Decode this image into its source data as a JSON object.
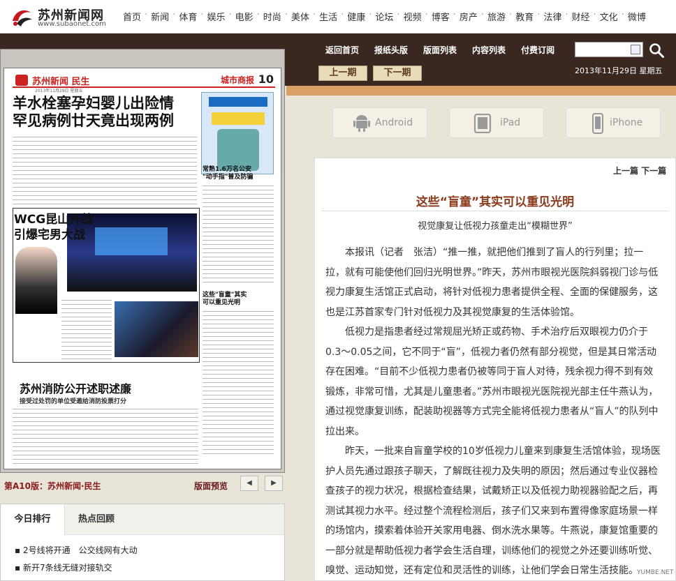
{
  "site": {
    "name": "苏州新闻网",
    "url": "www.subaonet.com"
  },
  "nav": [
    "首页",
    "新闻",
    "体育",
    "娱乐",
    "电影",
    "时尚",
    "美体",
    "生活",
    "健康",
    "论坛",
    "视频",
    "博客",
    "房产",
    "旅游",
    "教育",
    "法律",
    "财经",
    "文化",
    "微博"
  ],
  "subnav": [
    "返回首页",
    "报纸头版",
    "版面列表",
    "内容列表",
    "付费订阅"
  ],
  "search": {
    "value": ""
  },
  "issue": {
    "prev": "上一期",
    "next": "下一期",
    "date": "2013年11月29日 星期五"
  },
  "newspaper": {
    "section": "苏州新闻 民生",
    "paper_name": "城市商报",
    "page_number": "10",
    "dateline": "2013年11月29日 星期五",
    "headline": [
      "羊水栓塞孕妇婴儿出险情",
      "罕见病例廿天竟出现两例"
    ],
    "side1": [
      "常熟1.6万名公安",
      "\"动手指\"普及防骗"
    ],
    "wcg_title": [
      "WCG昆山开战",
      "引爆宅男大战"
    ],
    "side2": [
      "这些\"盲童\"其实",
      "可以重见光明"
    ],
    "fire_title": "苏州消防公开述职述廉",
    "fire_sub": "接受过处罚的单位受邀给消防投票打分"
  },
  "page_info": "第A10版：苏州新闻·民生",
  "preview_label": "版面预览",
  "ranking": {
    "tabs": [
      "今日排行",
      "热点回顾"
    ],
    "items": [
      "2号线将开通　公交线网有大动",
      "新开7条线无缝对接轨交"
    ]
  },
  "devices": [
    "Android",
    "iPad",
    "iPhone"
  ],
  "article": {
    "nav": "上一篇 下一篇",
    "title": "这些“盲童”其实可以重见光明",
    "subtitle": "视觉康复让低视力孩童走出“模糊世界”",
    "paragraphs": [
      "本报讯（记者　张洁）“推一推，就把他们推到了盲人的行列里；拉一拉，就有可能使他们回归光明世界。”昨天，苏州市眼视光医院斜弱视门诊与低视力康复生活馆正式启动，将针对低视力患者提供全程、全面的保健服务，这也是江苏首家专门针对低视力及其视觉康复的生活体验馆。",
      "低视力是指患者经过常规屈光矫正或药物、手术治疗后双眼视力仍介于0.3～0.05之间，它不同于“盲”，低视力者仍然有部分视觉，但是其日常活动存在困难。“目前不少低视力患者仍被等同于盲人对待，残余视力得不到有效锻炼，非常可惜，尤其是儿童患者。”苏州市眼视光医院视光部主任牛燕认为，通过视觉康复训练，配装助视器等方式完全能将低视力患者从“盲人”的队列中拉出来。",
      "昨天，一批来自盲童学校的10岁低视力儿童来到康复生活馆体验，现场医护人员先通过跟孩子聊天，了解既往视力及失明的原因；然后通过专业仪器检查孩子的视力状况，根据检查结果，试戴矫正以及低视力助视器验配之后，再测试其视力水平。经过整个流程检测后，孩子们又来到布置得像家庭场景一样的场馆内，摸索着体验开关家用电器、倒水洗水果等。牛燕说，康复馆重要的一部分就是帮助低视力者学会生活自理，训练他们的视觉之外还要训练听觉、嗅觉、运动知觉，还有定位和灵活性的训练，让他们学会日常生活技能。"
    ]
  },
  "watermark": "YUMBE.NET"
}
